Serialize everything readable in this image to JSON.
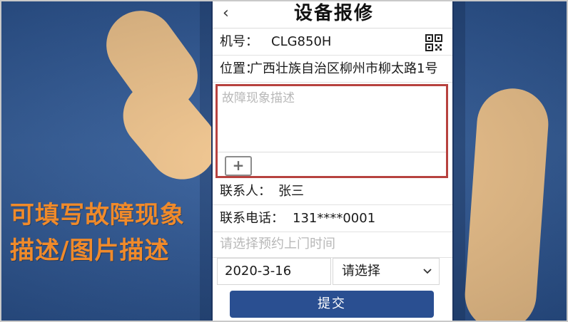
{
  "header": {
    "back_icon": "‹",
    "title": "设备报修"
  },
  "machine": {
    "label": "机号：",
    "value": "CLG850H"
  },
  "location": {
    "label": "位置：",
    "value": "广西壮族自治区柳州市柳太路1号"
  },
  "fault": {
    "placeholder": "故障现象描述",
    "add_label": "+"
  },
  "contact": {
    "label": "联系人：",
    "value": "张三"
  },
  "phone": {
    "label": "联系电话：",
    "value": "131****0001"
  },
  "appointment": {
    "placeholder": "请选择预约上门时间",
    "date": "2020-3-16",
    "time_select": "请选择"
  },
  "submit_label": "提交",
  "caption": {
    "line1": "可填写故障现象",
    "line2": "描述/图片描述"
  },
  "colors": {
    "background": "#2f5a96",
    "accent": "#2a4f91",
    "highlight_border": "#b7423f",
    "caption": "#f08a2a",
    "finger": "#f2c68e"
  }
}
